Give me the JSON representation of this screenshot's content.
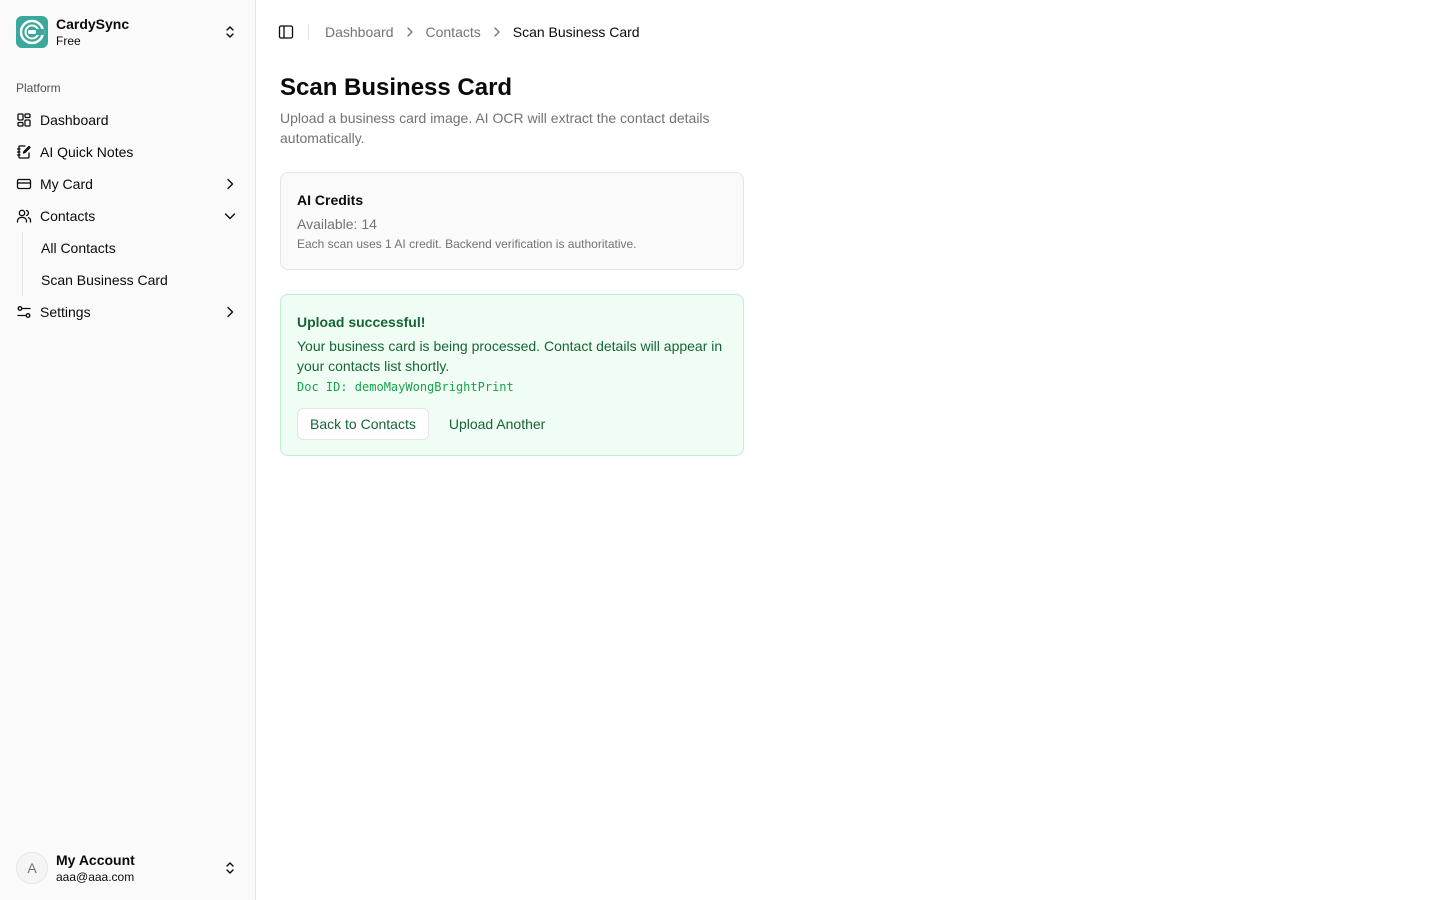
{
  "team": {
    "name": "CardySync",
    "plan": "Free"
  },
  "sidebar": {
    "group_label": "Platform",
    "items": [
      {
        "label": "Dashboard",
        "icon": "grid-icon"
      },
      {
        "label": "AI Quick Notes",
        "icon": "notebook-pen-icon"
      },
      {
        "label": "My Card",
        "icon": "credit-card-icon"
      },
      {
        "label": "Contacts",
        "icon": "users-icon"
      },
      {
        "label": "Settings",
        "icon": "settings-sliders-icon"
      }
    ],
    "contacts_sub": [
      {
        "label": "All Contacts"
      },
      {
        "label": "Scan Business Card"
      }
    ]
  },
  "user": {
    "initial": "A",
    "name": "My Account",
    "email": "aaa@aaa.com"
  },
  "breadcrumb": {
    "item1": "Dashboard",
    "item2": "Contacts",
    "current": "Scan Business Card"
  },
  "page": {
    "title": "Scan Business Card",
    "description": "Upload a business card image. AI OCR will extract the contact details automatically."
  },
  "credits": {
    "title": "AI Credits",
    "available": "Available: 14",
    "note": "Each scan uses 1 AI credit. Backend verification is authoritative."
  },
  "upload": {
    "title": "Upload successful!",
    "message": "Your business card is being processed. Contact details will appear in your contacts list shortly.",
    "doc_id": "Doc ID: demoMayWongBrightPrint",
    "back_label": "Back to Contacts",
    "another_label": "Upload Another"
  },
  "colors": {
    "brand": "#3aa79a",
    "success_bg": "#f0fdf4",
    "success_border": "#bbf0cc",
    "success_text": "#166534"
  }
}
